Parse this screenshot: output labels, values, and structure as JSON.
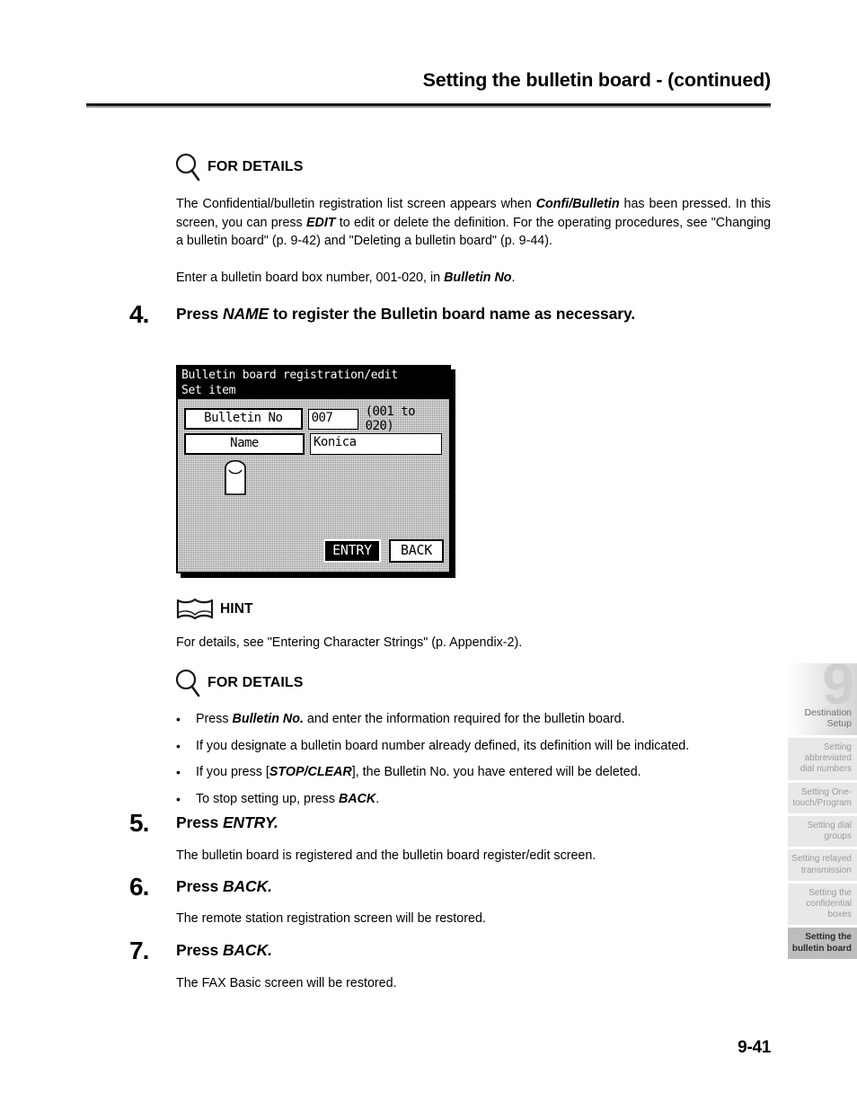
{
  "header": {
    "title": "Setting the bulletin board -  (continued)"
  },
  "details_1": {
    "label": "FOR DETAILS",
    "icon": "magnifier-icon",
    "paragraph_1_parts": [
      {
        "t": "The Confidential/bulletin registration list screen appears when ",
        "b": false
      },
      {
        "t": "Confi/Bulletin",
        "b": true
      },
      {
        "t": " has been pressed. In this screen, you can press ",
        "b": false
      },
      {
        "t": "EDIT",
        "b": true
      },
      {
        "t": " to edit or delete the definition. For the operating procedures, see \"Changing a bulletin board\" (p. 9-42) and \"Deleting a bulletin board\" (p. 9-44).",
        "b": false
      }
    ],
    "paragraph_2_parts": [
      {
        "t": "Enter a bulletin board box number, 001-020, in ",
        "b": false
      },
      {
        "t": "Bulletin No",
        "b": true
      },
      {
        "t": ".",
        "b": false
      }
    ]
  },
  "step4": {
    "number": "4.",
    "text_parts": [
      {
        "t": "Press ",
        "i": false
      },
      {
        "t": "NAME",
        "i": true
      },
      {
        "t": " to register the Bulletin board name as necessary.",
        "i": false
      }
    ]
  },
  "lcd": {
    "title_line1": "Bulletin board registration/edit",
    "title_line2": "Set item",
    "field_bulletin_label": "Bulletin No",
    "field_bulletin_value": "007",
    "field_bulletin_range": "(001 to 020)",
    "field_name_label": "Name",
    "field_name_value": "Konica",
    "key_entry": "ENTRY",
    "key_back": "BACK",
    "pointer_icon": "fingertip-pointer-icon"
  },
  "hint": {
    "label": "HINT",
    "icon": "open-book-icon",
    "text": "For details, see \"Entering Character Strings\" (p. Appendix-2)."
  },
  "details_2": {
    "label": "FOR DETAILS",
    "icon": "magnifier-icon",
    "bullets": [
      [
        {
          "t": "Press ",
          "b": false
        },
        {
          "t": "Bulletin No.",
          "b": true
        },
        {
          "t": " and enter the information required for the bulletin board.",
          "b": false
        }
      ],
      [
        {
          "t": "If you designate a bulletin board number already defined, its definition will be indicated.",
          "b": false
        }
      ],
      [
        {
          "t": "If you press [",
          "b": false
        },
        {
          "t": "STOP/CLEAR",
          "b": true
        },
        {
          "t": "], the Bulletin No. you have entered will be deleted.",
          "b": false
        }
      ],
      [
        {
          "t": "To stop setting up, press ",
          "b": false
        },
        {
          "t": "BACK",
          "b": true
        },
        {
          "t": ".",
          "b": false
        }
      ]
    ]
  },
  "step5": {
    "number": "5.",
    "text_parts": [
      {
        "t": "Press ",
        "i": false
      },
      {
        "t": "ENTRY.",
        "i": true
      }
    ],
    "desc": "The bulletin board is registered and the bulletin board register/edit screen."
  },
  "step6": {
    "number": "6.",
    "text_parts": [
      {
        "t": "Press ",
        "i": false
      },
      {
        "t": "BACK.",
        "i": true
      }
    ],
    "desc": "The remote station registration screen will be restored."
  },
  "step7": {
    "number": "7.",
    "text_parts": [
      {
        "t": "Press ",
        "i": false
      },
      {
        "t": "BACK.",
        "i": true
      }
    ],
    "desc": "The FAX Basic screen will be restored."
  },
  "tabs": {
    "chapter_number": "9",
    "chapter_label_line1": "Destination",
    "chapter_label_line2": "Setup",
    "items": [
      {
        "label": "Setting abbreviated dial numbers",
        "active": false
      },
      {
        "label": "Setting One-touch/Program",
        "active": false
      },
      {
        "label": "Setting dial groups",
        "active": false
      },
      {
        "label": "Setting relayed transmission",
        "active": false
      },
      {
        "label": "Setting the confidential boxes",
        "active": false
      },
      {
        "label": "Setting the bulletin board",
        "active": true
      }
    ]
  },
  "footer": {
    "page_number": "9-41"
  },
  "colors": {
    "accent_rule": "#1a1a1a",
    "rule_shadow": "#a6a6a6",
    "tab_inactive_bg": "#e8e8e8",
    "tab_active_bg": "#bdbdbd",
    "lcd_bg": "#8e8e8e"
  }
}
